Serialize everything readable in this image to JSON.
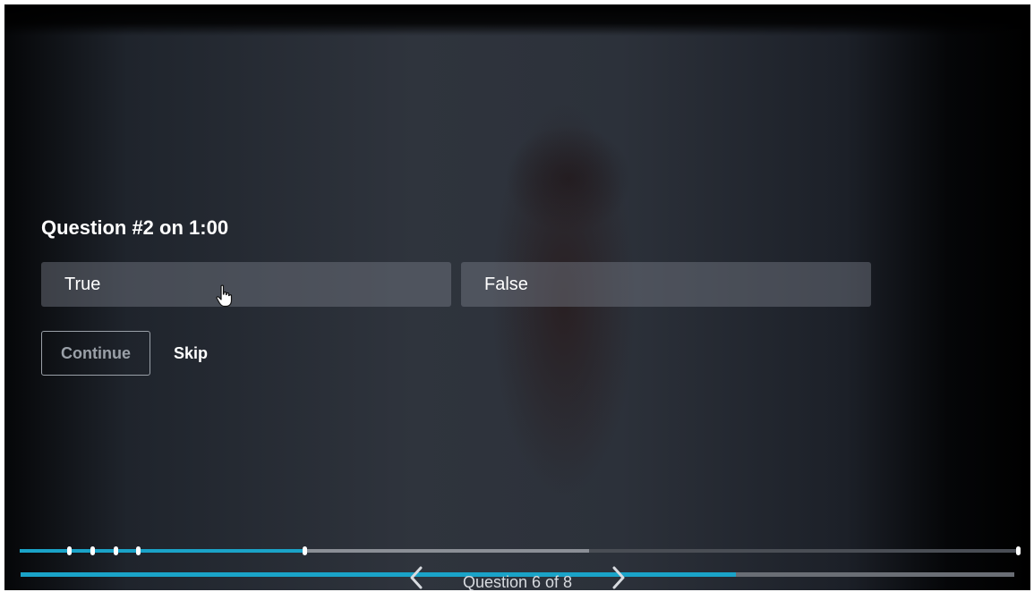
{
  "quiz": {
    "title": "Question #2 on 1:00",
    "options": [
      {
        "label": "True"
      },
      {
        "label": "False"
      }
    ],
    "continue_label": "Continue",
    "skip_label": "Skip"
  },
  "navigation": {
    "counter": "Question 6 of 8",
    "prev_icon": "chevron-left-icon",
    "next_icon": "chevron-right-icon"
  },
  "timeline": {
    "played_fraction": 0.286,
    "buffered_fraction": 0.57,
    "marker_fractions": [
      0.05,
      0.073,
      0.096,
      0.119,
      0.286,
      1.0
    ]
  },
  "progress": {
    "fraction": 0.72
  },
  "colors": {
    "accent": "#1aa3c8",
    "text": "#ffffff",
    "option_bg": "rgba(120,125,135,0.45)",
    "muted": "#9aa0a8"
  },
  "icons": {
    "cursor": "hand-pointer-icon"
  }
}
